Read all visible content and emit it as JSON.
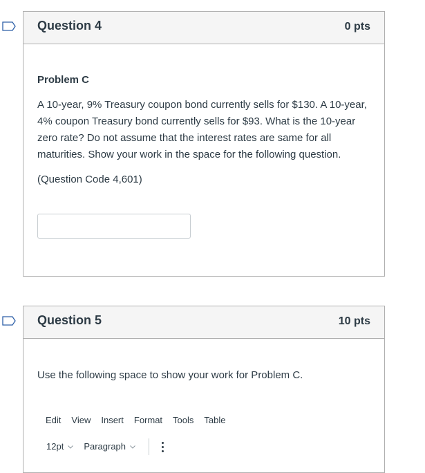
{
  "questions": [
    {
      "title": "Question 4",
      "points": "0 pts",
      "problem_title": "Problem C",
      "problem_text": "A 10-year, 9% Treasury coupon bond currently sells for $130. A 10-year, 4% coupon Treasury bond currently sells for $93. What is the 10-year zero rate? Do not assume that the interest rates are same for all maturities. Show your work in the space for the following question.",
      "question_code": "(Question Code 4,601)",
      "answer_value": "",
      "answer_placeholder": ""
    },
    {
      "title": "Question 5",
      "points": "10 pts",
      "prompt": "Use the following space to show your work for Problem C.",
      "editor": {
        "menu": [
          "Edit",
          "View",
          "Insert",
          "Format",
          "Tools",
          "Table"
        ],
        "font_size": "12pt",
        "block_format": "Paragraph"
      }
    }
  ],
  "icons": {
    "flag": "flag-outline-icon",
    "chevron": "chevron-down-icon",
    "more": "more-vertical-icon"
  },
  "colors": {
    "text": "#2d3b45",
    "header_bg": "#f5f5f5",
    "border": "#b0b0b0",
    "flag": "#2d5fa8"
  }
}
